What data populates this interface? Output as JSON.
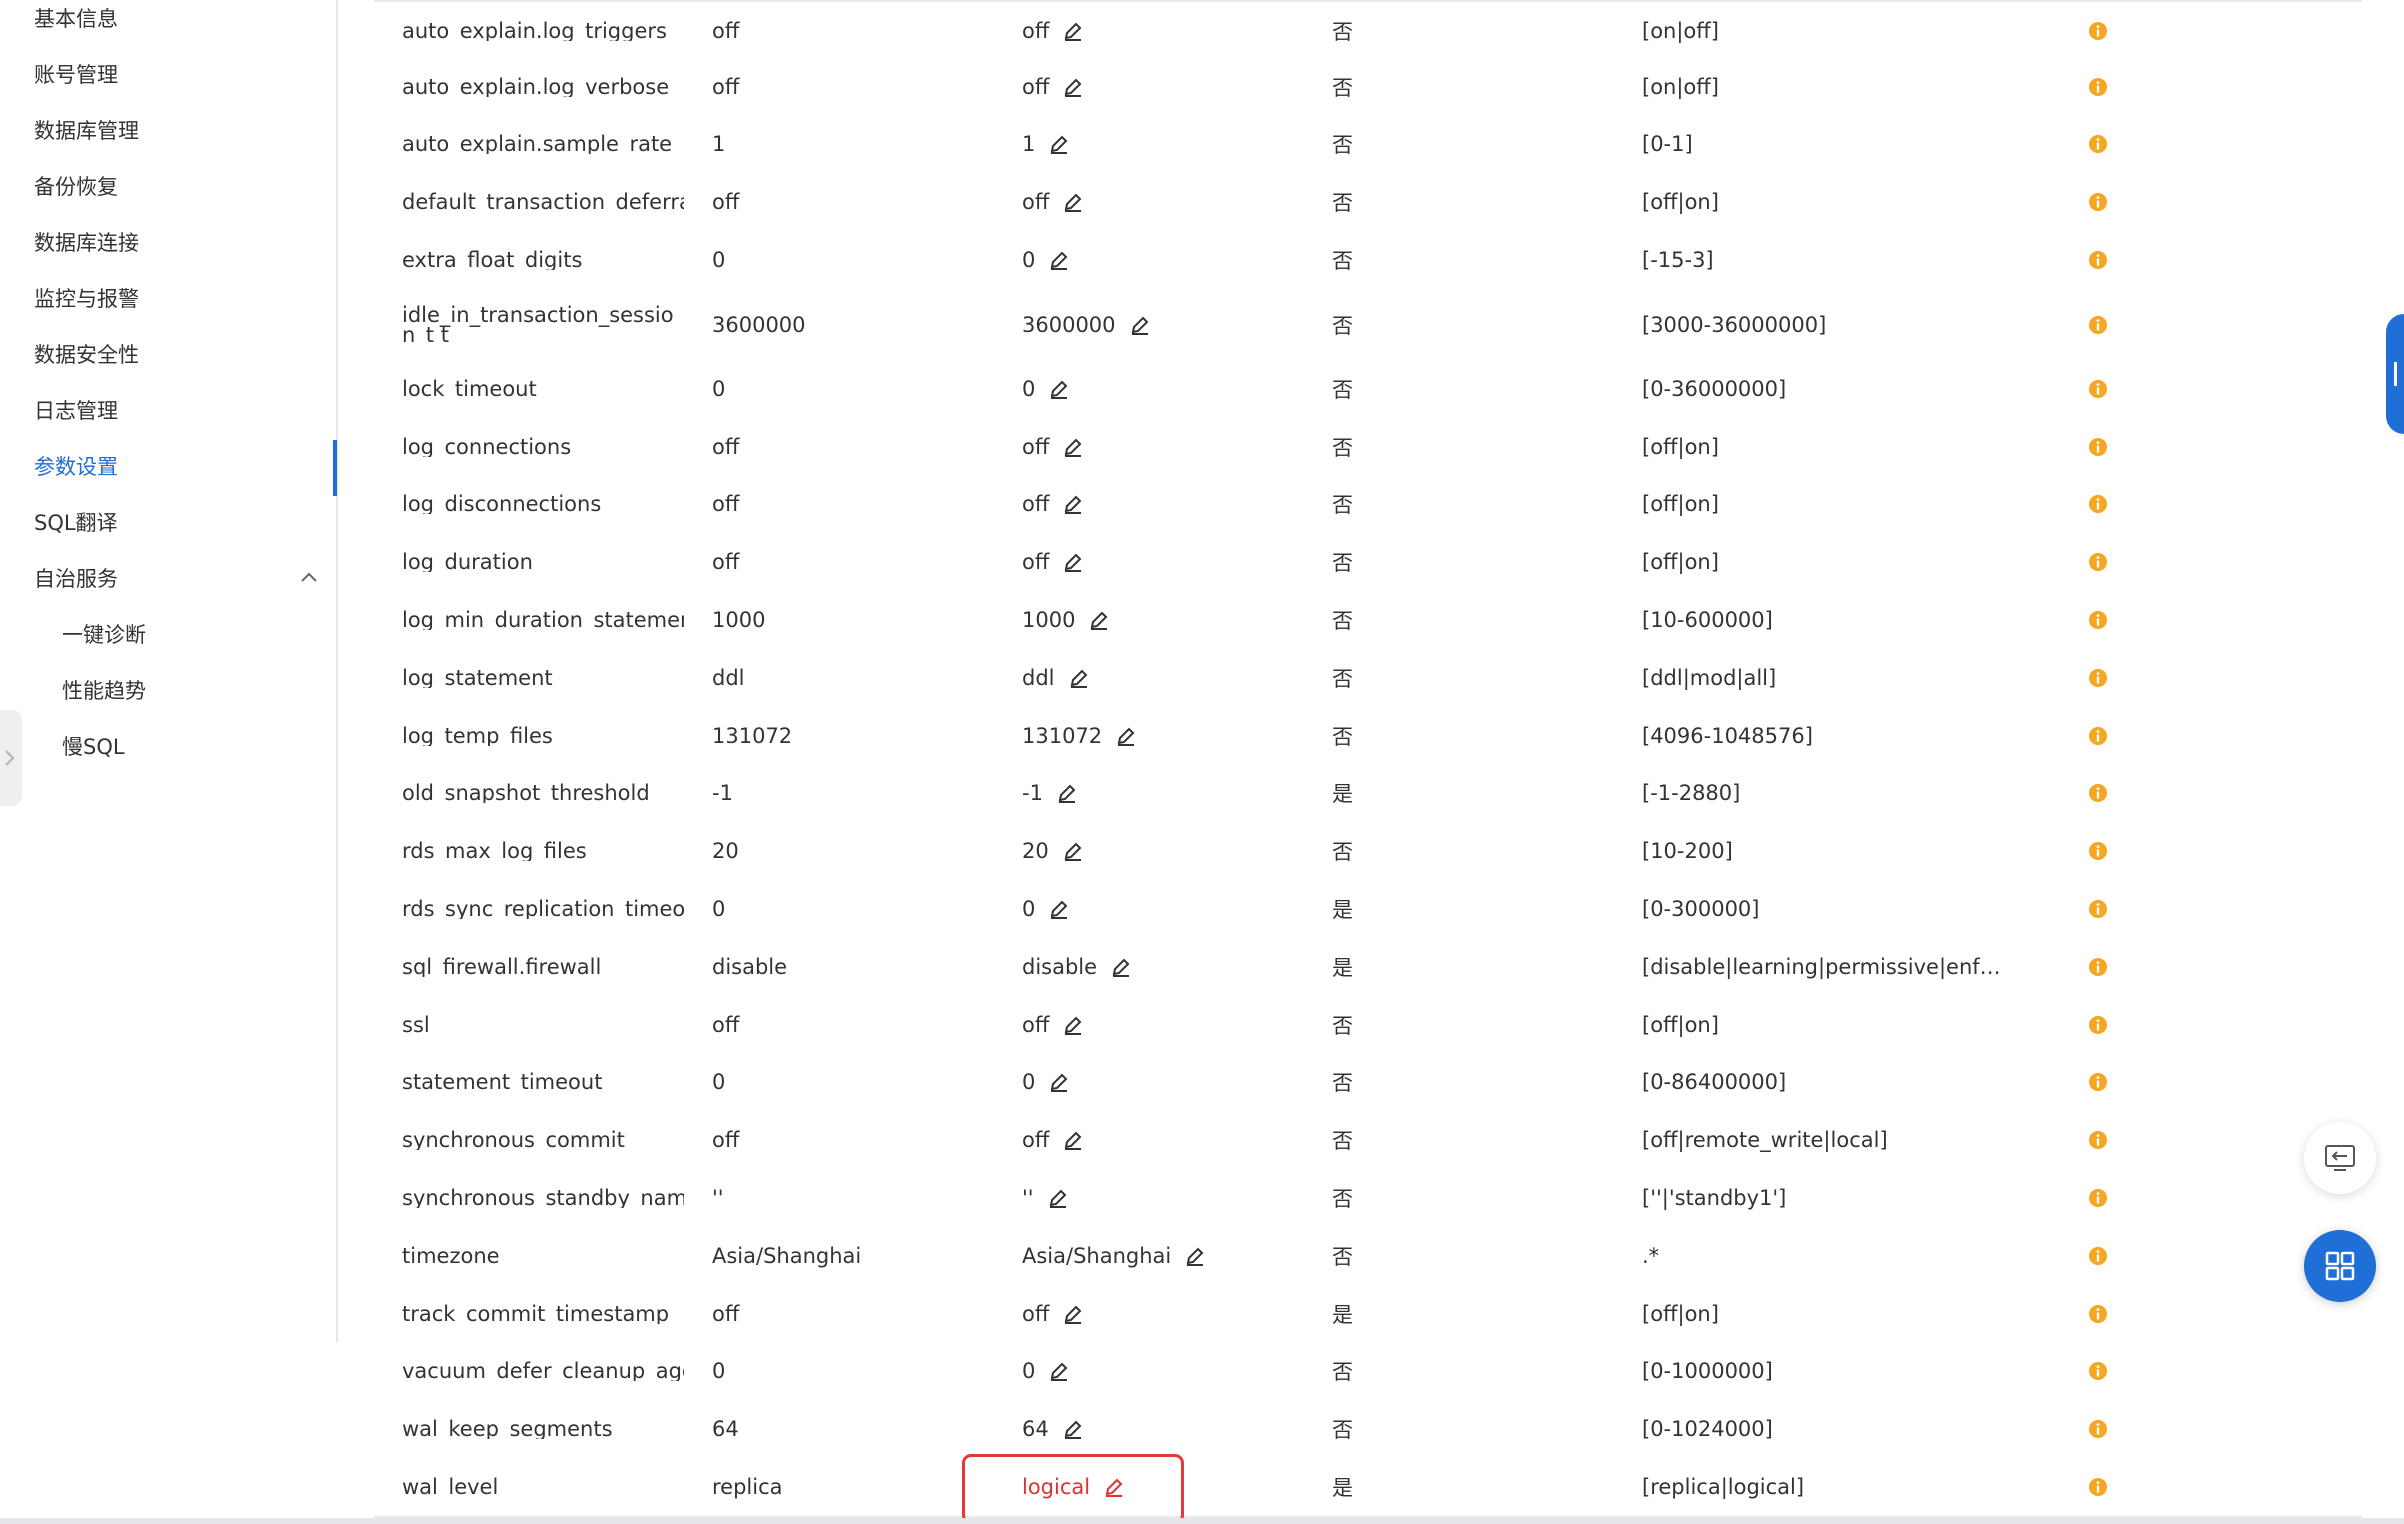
{
  "sidebar": {
    "items": [
      {
        "label": "基本信息"
      },
      {
        "label": "账号管理"
      },
      {
        "label": "数据库管理"
      },
      {
        "label": "备份恢复"
      },
      {
        "label": "数据库连接"
      },
      {
        "label": "监控与报警"
      },
      {
        "label": "数据安全性"
      },
      {
        "label": "日志管理"
      },
      {
        "label": "参数设置",
        "active": true
      },
      {
        "label": "SQL翻译"
      },
      {
        "label": "自治服务",
        "expanded": true
      }
    ],
    "subitems": [
      {
        "label": "一键诊断"
      },
      {
        "label": "性能趋势"
      },
      {
        "label": "慢SQL"
      }
    ]
  },
  "params": {
    "rows": [
      {
        "name": "auto_explain.log_triggers",
        "default": "off",
        "running": "off",
        "restart": "否",
        "range": "[on|off]"
      },
      {
        "name": "auto_explain.log_verbose",
        "default": "off",
        "running": "off",
        "restart": "否",
        "range": "[on|off]"
      },
      {
        "name": "auto_explain.sample_rate",
        "default": "1",
        "running": "1",
        "restart": "否",
        "range": "[0-1]"
      },
      {
        "name": "default_transaction_deferrab",
        "default": "off",
        "running": "off",
        "restart": "否",
        "range": "[off|on]"
      },
      {
        "name": "extra_float_digits",
        "default": "0",
        "running": "0",
        "restart": "否",
        "range": "[-15-3]"
      },
      {
        "name": "idle_in_transaction_session_t t",
        "default": "3600000",
        "running": "3600000",
        "restart": "否",
        "range": "[3000-36000000]"
      },
      {
        "name": "lock_timeout",
        "default": "0",
        "running": "0",
        "restart": "否",
        "range": "[0-36000000]"
      },
      {
        "name": "log_connections",
        "default": "off",
        "running": "off",
        "restart": "否",
        "range": "[off|on]"
      },
      {
        "name": "log_disconnections",
        "default": "off",
        "running": "off",
        "restart": "否",
        "range": "[off|on]"
      },
      {
        "name": "log_duration",
        "default": "off",
        "running": "off",
        "restart": "否",
        "range": "[off|on]"
      },
      {
        "name": "log_min_duration_statement",
        "default": "1000",
        "running": "1000",
        "restart": "否",
        "range": "[10-600000]"
      },
      {
        "name": "log_statement",
        "default": "ddl",
        "running": "ddl",
        "restart": "否",
        "range": "[ddl|mod|all]"
      },
      {
        "name": "log_temp_files",
        "default": "131072",
        "running": "131072",
        "restart": "否",
        "range": "[4096-1048576]"
      },
      {
        "name": "old_snapshot_threshold",
        "default": "-1",
        "running": "-1",
        "restart": "是",
        "range": "[-1-2880]"
      },
      {
        "name": "rds_max_log_files",
        "default": "20",
        "running": "20",
        "restart": "否",
        "range": "[10-200]"
      },
      {
        "name": "rds_sync_replication_timeout",
        "default": "0",
        "running": "0",
        "restart": "是",
        "range": "[0-300000]"
      },
      {
        "name": "sql_firewall.firewall",
        "default": "disable",
        "running": "disable",
        "restart": "是",
        "range": "[disable|learning|permissive|enforc..."
      },
      {
        "name": "ssl",
        "default": "off",
        "running": "off",
        "restart": "否",
        "range": "[off|on]"
      },
      {
        "name": "statement_timeout",
        "default": "0",
        "running": "0",
        "restart": "否",
        "range": "[0-86400000]"
      },
      {
        "name": "synchronous_commit",
        "default": "off",
        "running": "off",
        "restart": "否",
        "range": "[off|remote_write|local]"
      },
      {
        "name": "synchronous_standby_names",
        "default": "''",
        "running": "''",
        "restart": "否",
        "range": "[''|'standby1']"
      },
      {
        "name": "timezone",
        "default": "Asia/Shanghai",
        "running": "Asia/Shanghai",
        "restart": "否",
        "range": ".*"
      },
      {
        "name": "track_commit_timestamp",
        "default": "off",
        "running": "off",
        "restart": "是",
        "range": "[off|on]"
      },
      {
        "name": "vacuum_defer_cleanup_age",
        "default": "0",
        "running": "0",
        "restart": "否",
        "range": "[0-1000000]"
      },
      {
        "name": "wal_keep_segments",
        "default": "64",
        "running": "64",
        "restart": "否",
        "range": "[0-1024000]"
      },
      {
        "name": "wal_level",
        "default": "replica",
        "running": "logical",
        "restart": "是",
        "range": "[replica|logical]",
        "modified": true
      }
    ]
  },
  "colors": {
    "accent": "#1f6fd6",
    "info_icon": "#f5a623",
    "modified_value": "#e0322f",
    "highlight_box": "#e53935"
  },
  "icons": {
    "edit": "pencil-icon",
    "info": "info-circle-icon",
    "expand": "chevron-up-icon",
    "feedback": "feedback-icon",
    "apps": "grid-icon"
  }
}
